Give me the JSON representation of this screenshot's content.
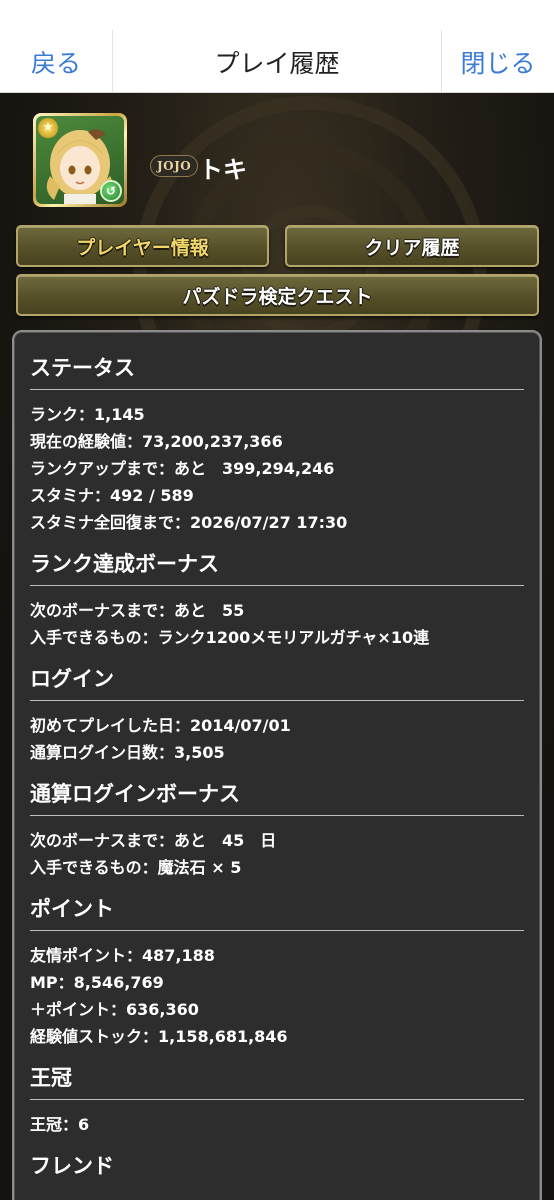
{
  "nav": {
    "back": "戻る",
    "title": "プレイ履歴",
    "close": "閉じる"
  },
  "player": {
    "badge": "JOJO",
    "name": "トキ"
  },
  "buttons": {
    "player_info": "プレイヤー情報",
    "clear_history": "クリア履歴",
    "quest": "パズドラ検定クエスト"
  },
  "sections": [
    {
      "title": "ステータス",
      "lines": [
        "ランク：1,145",
        "現在の経験値：73,200,237,366",
        "ランクアップまで：あと　399,294,246",
        "スタミナ：492 / 589",
        "スタミナ全回復まで：2026/07/27 17:30"
      ]
    },
    {
      "title": "ランク達成ボーナス",
      "lines": [
        "次のボーナスまで：あと　55",
        "入手できるもの：ランク1200メモリアルガチャ×10連"
      ]
    },
    {
      "title": "ログイン",
      "lines": [
        "初めてプレイした日：2014/07/01",
        "通算ログイン日数：3,505"
      ]
    },
    {
      "title": "通算ログインボーナス",
      "lines": [
        "次のボーナスまで：あと　45　日",
        "入手できるもの：魔法石 × 5"
      ]
    },
    {
      "title": "ポイント",
      "lines": [
        "友情ポイント：487,188",
        "MP：8,546,769",
        "＋ポイント：636,360",
        "経験値ストック：1,158,681,846"
      ]
    },
    {
      "title": "王冠",
      "lines": [
        "王冠：6"
      ]
    },
    {
      "title": "フレンド",
      "lines": []
    }
  ],
  "colors": {
    "link": "#3a7bd5",
    "panel": "#2d2d2d",
    "button_gold_text": "#f1d66a"
  }
}
